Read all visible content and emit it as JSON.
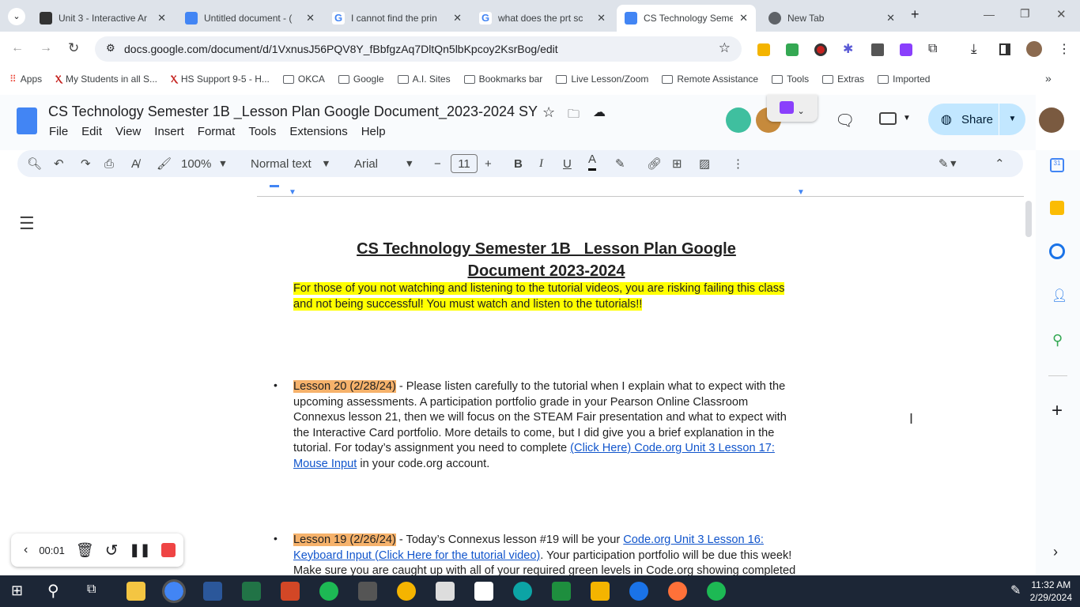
{
  "tabs": [
    {
      "title": "Unit 3 - Interactive Ar",
      "color": "#333"
    },
    {
      "title": "Untitled document - (",
      "color": "#4285f4"
    },
    {
      "title": "I cannot find the prin",
      "color": "#ea4335"
    },
    {
      "title": "what does the prt sc",
      "color": "#ea4335"
    },
    {
      "title": "CS Technology Semes",
      "color": "#4285f4"
    },
    {
      "title": "New Tab",
      "color": "#5f6368"
    }
  ],
  "url": "docs.google.com/document/d/1VxnusJ56PQV8Y_fBbfgzAq7DltQn5lbKpcoy2KsrBog/edit",
  "bookmarks": [
    "Apps",
    "My Students in all S...",
    "HS Support 9-5 - H...",
    "OKCA",
    "Google",
    "A.I. Sites",
    "Bookmarks bar",
    "Live Lesson/Zoom",
    "Remote Assistance",
    "Tools",
    "Extras",
    "Imported"
  ],
  "doc_title": "CS Technology Semester 1B _Lesson Plan Google Document_2023-2024 SY",
  "menus": [
    "File",
    "Edit",
    "View",
    "Insert",
    "Format",
    "Tools",
    "Extensions",
    "Help"
  ],
  "toolbar": {
    "zoom": "100%",
    "style": "Normal text",
    "font": "Arial",
    "size": "11"
  },
  "share": "Share",
  "body": {
    "heading1": "CS Technology Semester 1B _Lesson Plan Google",
    "heading2": "Document  2023-2024",
    "warning": "For those of you not watching and listening to the tutorial videos, you are risking failing this class and not being successful!  You must watch and listen to the tutorials!!",
    "l20_tag": "Lesson 20  (2/28/24)",
    "l20_text": " - Please listen carefully to the tutorial when I explain what to expect with the upcoming assessments.  A participation portfolio grade in your Pearson Online Classroom Connexus lesson 21, then we will focus on the STEAM Fair presentation and what to expect with the Interactive Card portfolio.  More details to come, but I did give you a brief explanation in the tutorial.  For today’s assignment you need to complete ",
    "l20_link": "(Click Here) Code.org Unit 3 Lesson 17: Mouse Input",
    "l20_end": " in your code.org account.",
    "l19_tag": "Lesson 19  (2/26/24)",
    "l19_text": " - Today’s Connexus lesson #19 will be your ",
    "l19_link": "Code.org Unit 3 Lesson 16: Keyboard Input (Click Here for the tutorial video)",
    "l19_end": ".  Your participation portfolio will be due this week! Make sure you are caught up with all of your required green levels in Code.org showing completed"
  },
  "recorder": {
    "time": "00:01"
  },
  "clock": {
    "time": "11:32 AM",
    "date": "2/29/2024"
  }
}
